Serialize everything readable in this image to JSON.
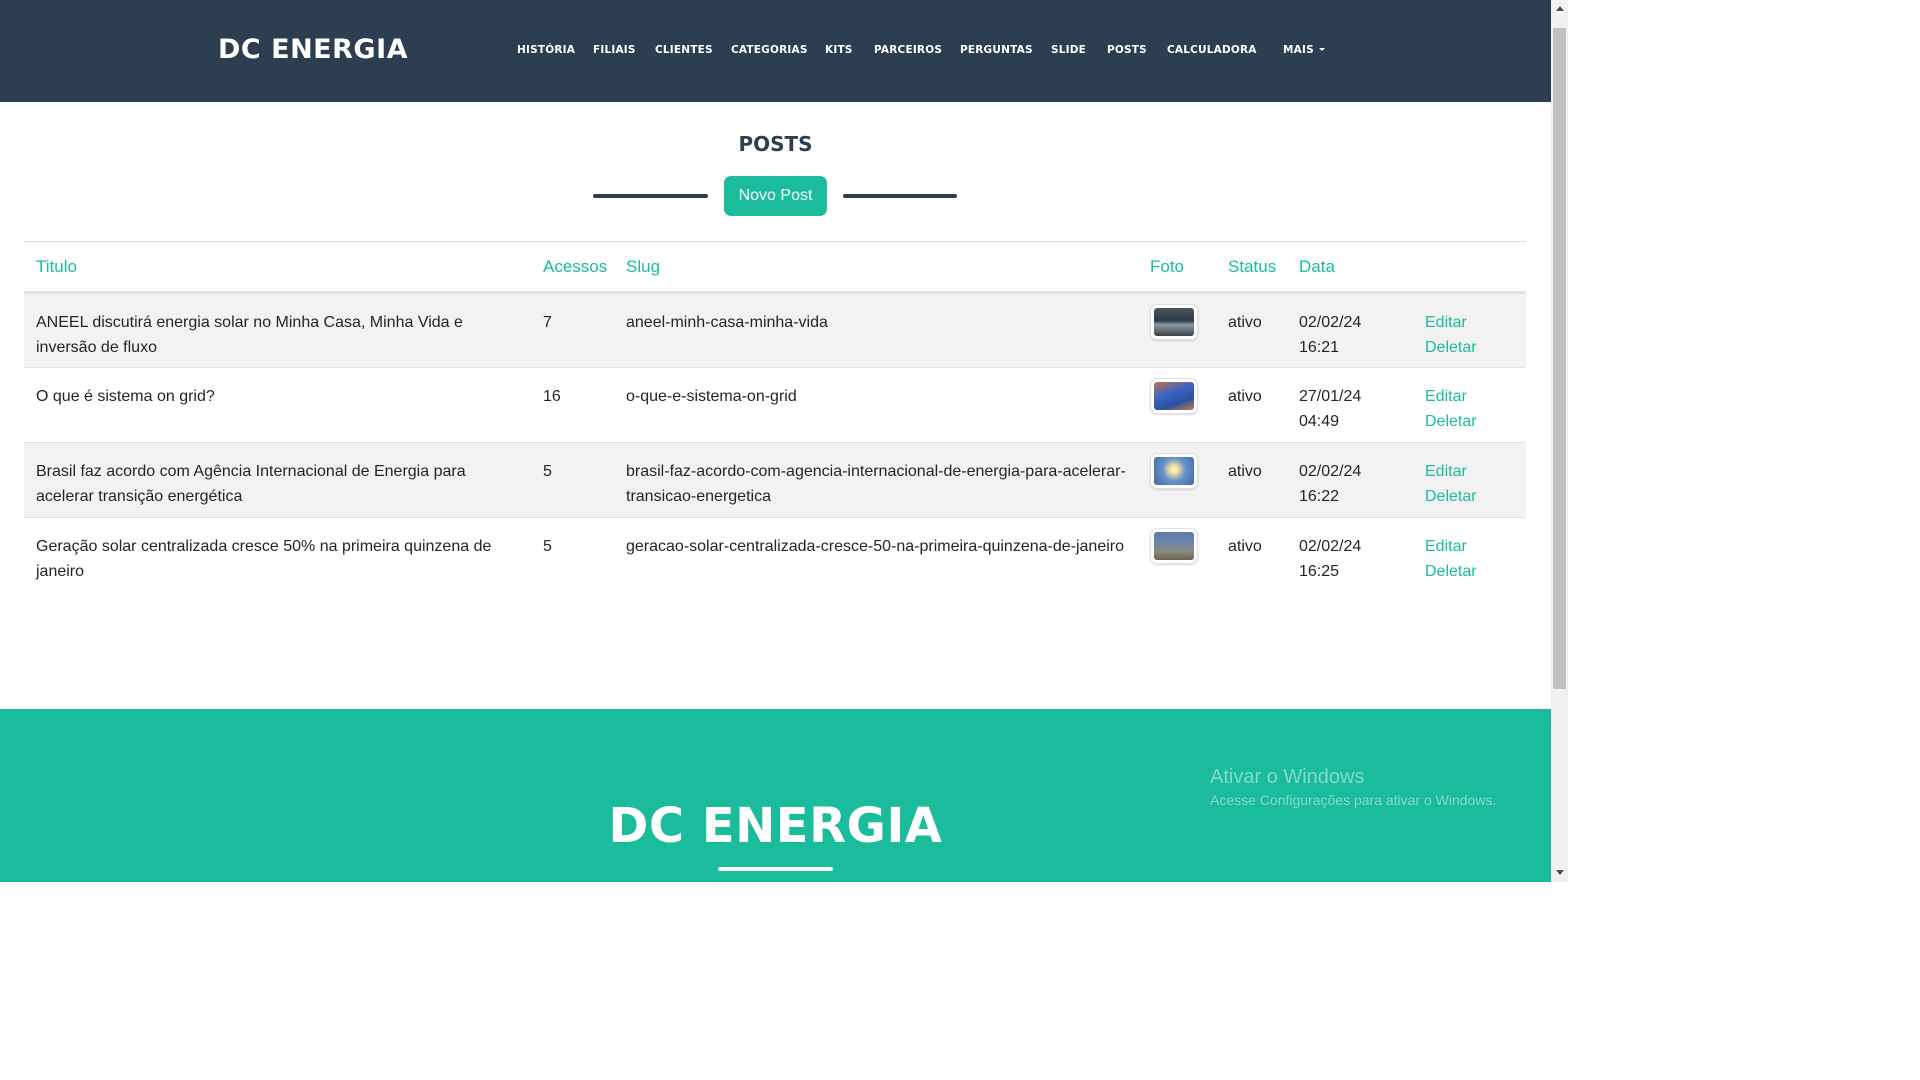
{
  "navbar": {
    "brand": "DC ENERGIA",
    "links": [
      {
        "label": "HISTÓRIA"
      },
      {
        "label": "FILIAIS"
      },
      {
        "label": "CLIENTES"
      },
      {
        "label": "CATEGORIAS"
      },
      {
        "label": "KITS"
      },
      {
        "label": "PARCEIROS"
      },
      {
        "label": "PERGUNTAS"
      },
      {
        "label": "SLIDE"
      },
      {
        "label": "POSTS"
      },
      {
        "label": "CALCULADORA"
      }
    ],
    "more_label": "MAIS"
  },
  "main": {
    "heading": "POSTS",
    "new_button": "Novo Post"
  },
  "table": {
    "headers": {
      "title": "Titulo",
      "views": "Acessos",
      "slug": "Slug",
      "photo": "Foto",
      "status": "Status",
      "date": "Data"
    },
    "rows": [
      {
        "title": "ANEEL discutirá energia solar no Minha Casa, Minha Vida e inversão de fluxo",
        "views": "7",
        "slug": "aneel-minh-casa-minha-vida",
        "photo_icon": "office-photo",
        "status": "ativo",
        "date": "02/02/24",
        "time": "16:21",
        "edit": "Editar",
        "delete": "Deletar"
      },
      {
        "title": "O que é sistema on grid?",
        "views": "16",
        "slug": "o-que-e-sistema-on-grid",
        "photo_icon": "solar-panels-photo",
        "status": "ativo",
        "date": "27/01/24",
        "time": "04:49",
        "edit": "Editar",
        "delete": "Deletar"
      },
      {
        "title": "Brasil faz acordo com Agência Internacional de Energia para acelerar transição energética",
        "views": "5",
        "slug": "brasil-faz-acordo-com-agencia-internacional-de-energia-para-acelerar-transicao-energetica",
        "photo_icon": "sunrise-photo",
        "status": "ativo",
        "date": "02/02/24",
        "time": "16:22",
        "edit": "Editar",
        "delete": "Deletar"
      },
      {
        "title": "Geração solar centralizada cresce 50% na primeira quinzena de janeiro",
        "views": "5",
        "slug": "geracao-solar-centralizada-cresce-50-na-primeira-quinzena-de-janeiro",
        "photo_icon": "solar-field-photo",
        "status": "ativo",
        "date": "02/02/24",
        "time": "16:25",
        "edit": "Editar",
        "delete": "Deletar"
      }
    ]
  },
  "footer": {
    "brand": "DC ENERGIA"
  },
  "watermark": {
    "title": "Ativar o Windows",
    "subtitle": "Acesse Configurações para ativar o Windows."
  },
  "colors": {
    "navbar_bg": "#2c3e50",
    "accent": "#1abc9c",
    "stripe": "#f2f2f2"
  }
}
